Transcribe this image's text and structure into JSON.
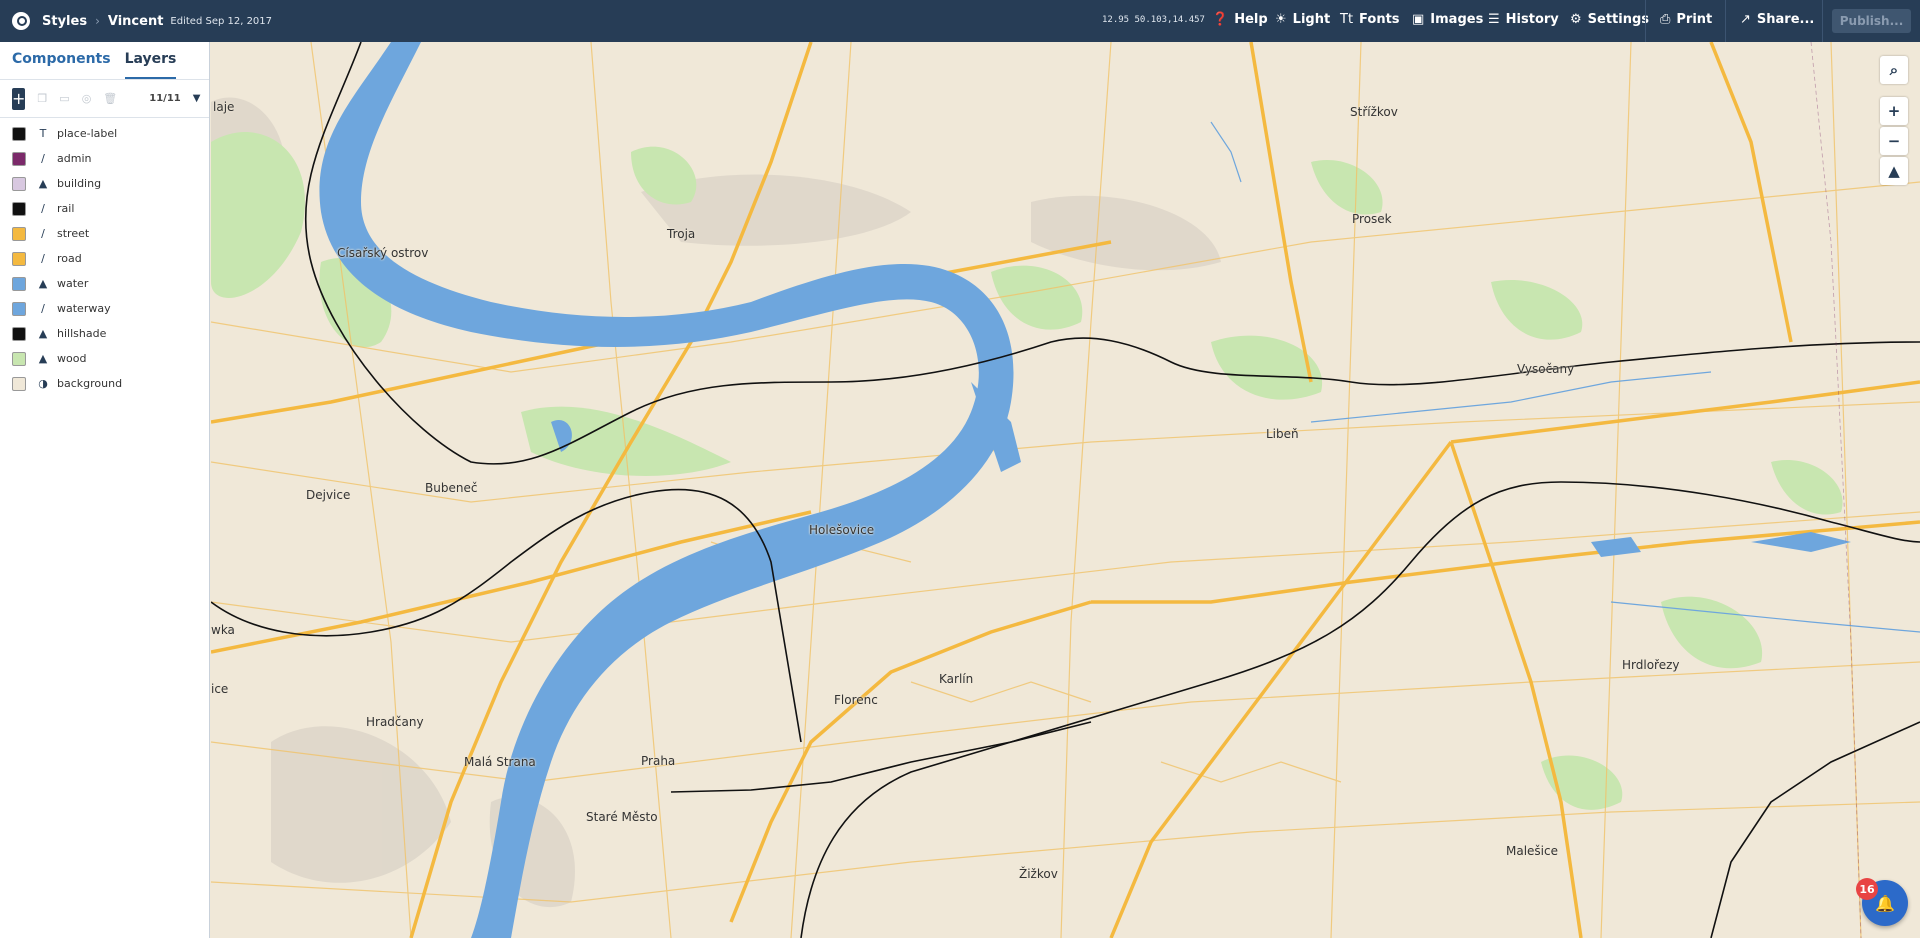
{
  "header": {
    "breadcrumb_root": "Styles",
    "style_name": "Vincent",
    "edited": "Edited Sep 12, 2017",
    "coordinates": "12.95 50.103,14.457",
    "help": "Help",
    "theme": "Light",
    "fonts": "Fonts",
    "images": "Images",
    "history": "History",
    "settings": "Settings",
    "print": "Print",
    "share": "Share...",
    "publish": "Publish..."
  },
  "sidebar": {
    "tabs": [
      "Components",
      "Layers"
    ],
    "active_tab": "Layers",
    "layer_count": "11/11",
    "layers": [
      {
        "name": "place-label",
        "color": "#111111",
        "type_icon": "T"
      },
      {
        "name": "admin",
        "color": "#7b2a6a",
        "type_icon": "line"
      },
      {
        "name": "building",
        "color": "#d8c8e0",
        "type_icon": "fill"
      },
      {
        "name": "rail",
        "color": "#111111",
        "type_icon": "line"
      },
      {
        "name": "street",
        "color": "#f4b940",
        "type_icon": "line"
      },
      {
        "name": "road",
        "color": "#f4b940",
        "type_icon": "line"
      },
      {
        "name": "water",
        "color": "#6ea6dd",
        "type_icon": "fill"
      },
      {
        "name": "waterway",
        "color": "#6ea6dd",
        "type_icon": "line"
      },
      {
        "name": "hillshade",
        "color": "#111111",
        "type_icon": "fill"
      },
      {
        "name": "wood",
        "color": "#c8e6b0",
        "type_icon": "fill"
      },
      {
        "name": "background",
        "color": "#f0e8d8",
        "type_icon": "background"
      }
    ]
  },
  "map": {
    "places": [
      "Střížkov",
      "Prosek",
      "Troja",
      "Císařský ostrov",
      "laje",
      "Vysočany",
      "Libeň",
      "Dejvice",
      "Bubeneč",
      "Holešovice",
      "wka",
      "ice",
      "Karlín",
      "Florenc",
      "Hrdlořezy",
      "Hradčany",
      "Malá Strana",
      "Praha",
      "Staré Město",
      "Žižkov",
      "Malešice"
    ],
    "notification_count": "16",
    "colors": {
      "land": "#f0e8d8",
      "water": "#6ea6dd",
      "road": "#f4b940",
      "wood": "#c8e6b0",
      "rail": "#111111"
    }
  }
}
